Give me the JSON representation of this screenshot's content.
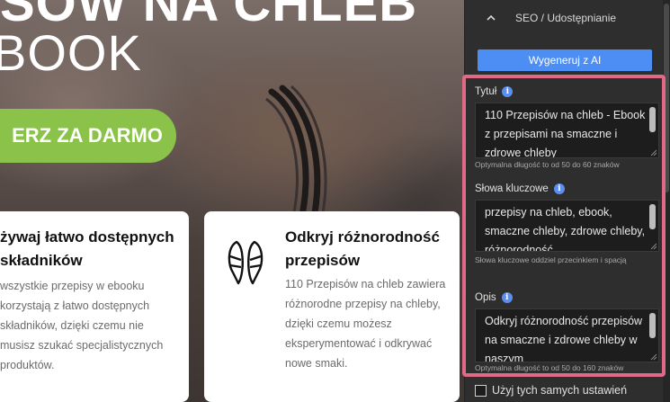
{
  "preview": {
    "hero_title_top": "SÓW NA CHLEB",
    "hero_title_2": "BOOK",
    "cta_label": "ERZ ZA DARMO",
    "card1": {
      "title": "żywaj łatwo dostępnych składników",
      "text": "wszystkie przepisy w ebooku korzystają z łatwo dostępnych składników, dzięki czemu nie musisz szukać specjalistycznych produktów."
    },
    "card2": {
      "title": "Odkryj różnorodność przepisów",
      "text": "110 Przepisów na chleb zawiera różnorodne przepisy na chleby, dzięki czemu możesz eksperymentować i odkrywać nowe smaki."
    }
  },
  "panel": {
    "section_title": "SEO / Udostępnianie",
    "generate_label": "Wygeneruj z AI",
    "title_label": "Tytuł",
    "title_value": "110 Przepisów na chleb - Ebook z przepisami na smaczne i zdrowe chleby",
    "title_hint": "Optymalna długość to od 50 do 60 znaków",
    "keywords_label": "Słowa kluczowe",
    "keywords_value": "przepisy na chleb, ebook, smaczne chleby, zdrowe chleby, różnorodność",
    "keywords_hint": "Słowa kluczowe oddziel przecinkiem i spacją",
    "desc_label": "Opis",
    "desc_value": "Odkryj różnorodność przepisów na smaczne i zdrowe chleby w naszym",
    "desc_hint": "Optymalna długość to od 50 do 160 znaków",
    "checkbox_label": "Użyj tych samych ustawień"
  },
  "colors": {
    "accent": "#4d8ef5",
    "cta_green": "#8bc34a",
    "highlight": "#e06a86"
  }
}
